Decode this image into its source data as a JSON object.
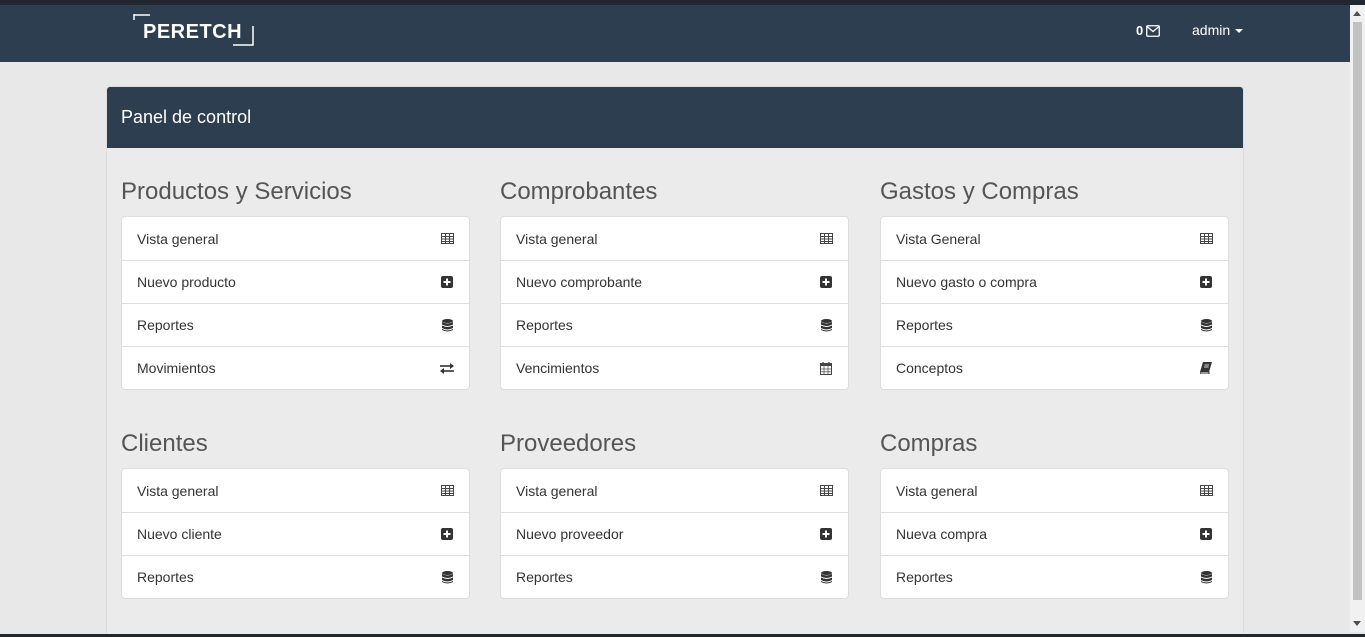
{
  "brand": {
    "name": "PERETCH"
  },
  "navbar": {
    "message_count": "0",
    "user": "admin"
  },
  "panel": {
    "title": "Panel de control"
  },
  "sections": [
    {
      "title": "Productos y Servicios",
      "items": [
        {
          "label": "Vista general",
          "icon": "table-icon"
        },
        {
          "label": "Nuevo producto",
          "icon": "plus-square-icon"
        },
        {
          "label": "Reportes",
          "icon": "database-icon"
        },
        {
          "label": "Movimientos",
          "icon": "exchange-icon"
        }
      ]
    },
    {
      "title": "Comprobantes",
      "items": [
        {
          "label": "Vista general",
          "icon": "table-icon"
        },
        {
          "label": "Nuevo comprobante",
          "icon": "plus-square-icon"
        },
        {
          "label": "Reportes",
          "icon": "database-icon"
        },
        {
          "label": "Vencimientos",
          "icon": "calendar-icon"
        }
      ]
    },
    {
      "title": "Gastos y Compras",
      "items": [
        {
          "label": "Vista General",
          "icon": "table-icon"
        },
        {
          "label": "Nuevo gasto o compra",
          "icon": "plus-square-icon"
        },
        {
          "label": "Reportes",
          "icon": "database-icon"
        },
        {
          "label": "Conceptos",
          "icon": "book-icon"
        }
      ]
    },
    {
      "title": "Clientes",
      "items": [
        {
          "label": "Vista general",
          "icon": "table-icon"
        },
        {
          "label": "Nuevo cliente",
          "icon": "plus-square-icon"
        },
        {
          "label": "Reportes",
          "icon": "database-icon"
        }
      ]
    },
    {
      "title": "Proveedores",
      "items": [
        {
          "label": "Vista general",
          "icon": "table-icon"
        },
        {
          "label": "Nuevo proveedor",
          "icon": "plus-square-icon"
        },
        {
          "label": "Reportes",
          "icon": "database-icon"
        }
      ]
    },
    {
      "title": "Compras",
      "items": [
        {
          "label": "Vista general",
          "icon": "table-icon"
        },
        {
          "label": "Nueva compra",
          "icon": "plus-square-icon"
        },
        {
          "label": "Reportes",
          "icon": "database-icon"
        }
      ]
    }
  ],
  "colors": {
    "navbar": "#2d3e50",
    "background": "#e8e8e8"
  }
}
